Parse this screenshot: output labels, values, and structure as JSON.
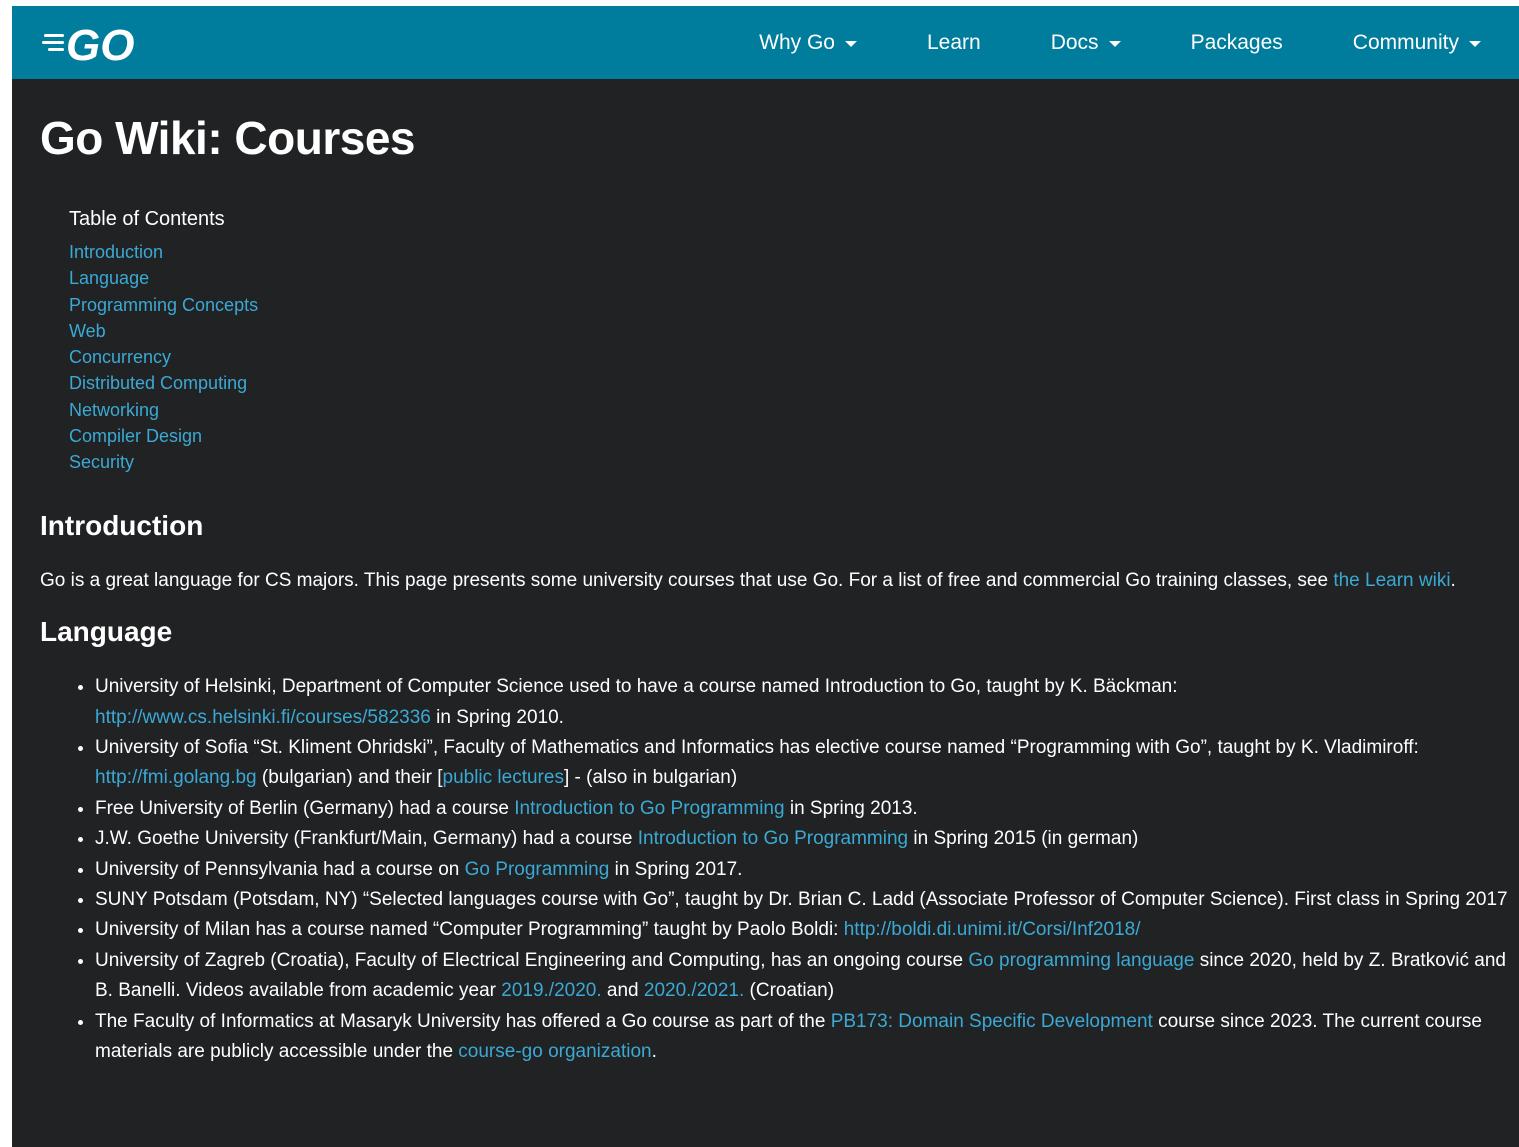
{
  "header": {
    "logo_text": "GO",
    "nav": [
      {
        "label": "Why Go",
        "dropdown": true
      },
      {
        "label": "Learn",
        "dropdown": false
      },
      {
        "label": "Docs",
        "dropdown": true
      },
      {
        "label": "Packages",
        "dropdown": false
      },
      {
        "label": "Community",
        "dropdown": true
      }
    ]
  },
  "page": {
    "title": "Go Wiki: Courses",
    "toc_title": "Table of Contents",
    "toc": [
      "Introduction",
      "Language",
      "Programming Concepts",
      "Web",
      "Concurrency",
      "Distributed Computing",
      "Networking",
      "Compiler Design",
      "Security"
    ]
  },
  "intro": {
    "heading": "Introduction",
    "text_before": "Go is a great language for CS majors. This page presents some university courses that use Go. For a list of free and commercial Go training classes, see ",
    "link": "the Learn wiki",
    "text_after": "."
  },
  "language": {
    "heading": "Language",
    "items": [
      [
        {
          "t": "University of Helsinki, Department of Computer Science used to have a course named Introduction to Go, taught by K. Bäckman: "
        },
        {
          "l": "http://www.cs.helsinki.fi/courses/582336"
        },
        {
          "t": " in Spring 2010."
        }
      ],
      [
        {
          "t": "University of Sofia “St. Kliment Ohridski”, Faculty of Mathematics and Informatics has elective course named “Programming with Go”, taught by K. Vladimiroff: "
        },
        {
          "l": "http://fmi.golang.bg"
        },
        {
          "t": " (bulgarian) and their ["
        },
        {
          "l": "public lectures"
        },
        {
          "t": "] - (also in bulgarian)"
        }
      ],
      [
        {
          "t": "Free University of Berlin (Germany) had a course "
        },
        {
          "l": "Introduction to Go Programming"
        },
        {
          "t": " in Spring 2013."
        }
      ],
      [
        {
          "t": "J.W. Goethe University (Frankfurt/Main, Germany) had a course "
        },
        {
          "l": "Introduction to Go Programming"
        },
        {
          "t": " in Spring 2015 (in german)"
        }
      ],
      [
        {
          "t": "University of Pennsylvania had a course on "
        },
        {
          "l": "Go Programming"
        },
        {
          "t": " in Spring 2017."
        }
      ],
      [
        {
          "t": "SUNY Potsdam (Potsdam, NY) “Selected languages course with Go”, taught by Dr. Brian C. Ladd (Associate Professor of Computer Science). First class in Spring 2017"
        }
      ],
      [
        {
          "t": "University of Milan has a course named “Computer Programming” taught by Paolo Boldi: "
        },
        {
          "l": "http://boldi.di.unimi.it/Corsi/Inf2018/"
        }
      ],
      [
        {
          "t": "University of Zagreb (Croatia), Faculty of Electrical Engineering and Computing, has an ongoing course "
        },
        {
          "l": "Go programming language"
        },
        {
          "t": " since 2020, held by Z. Bratković and B. Banelli. Videos available from academic year "
        },
        {
          "l": "2019./2020."
        },
        {
          "t": " and "
        },
        {
          "l": "2020./2021."
        },
        {
          "t": " (Croatian)"
        }
      ],
      [
        {
          "t": "The Faculty of Informatics at Masaryk University has offered a Go course as part of the "
        },
        {
          "l": "PB173: Domain Specific Development"
        },
        {
          "t": " course since 2023. The current course materials are publicly accessible under the "
        },
        {
          "l": "course-go organization"
        },
        {
          "t": "."
        }
      ]
    ]
  },
  "colors": {
    "header_bg": "#007d9c",
    "page_bg": "#202224",
    "link": "#3ba9d4",
    "text": "#ffffff"
  }
}
